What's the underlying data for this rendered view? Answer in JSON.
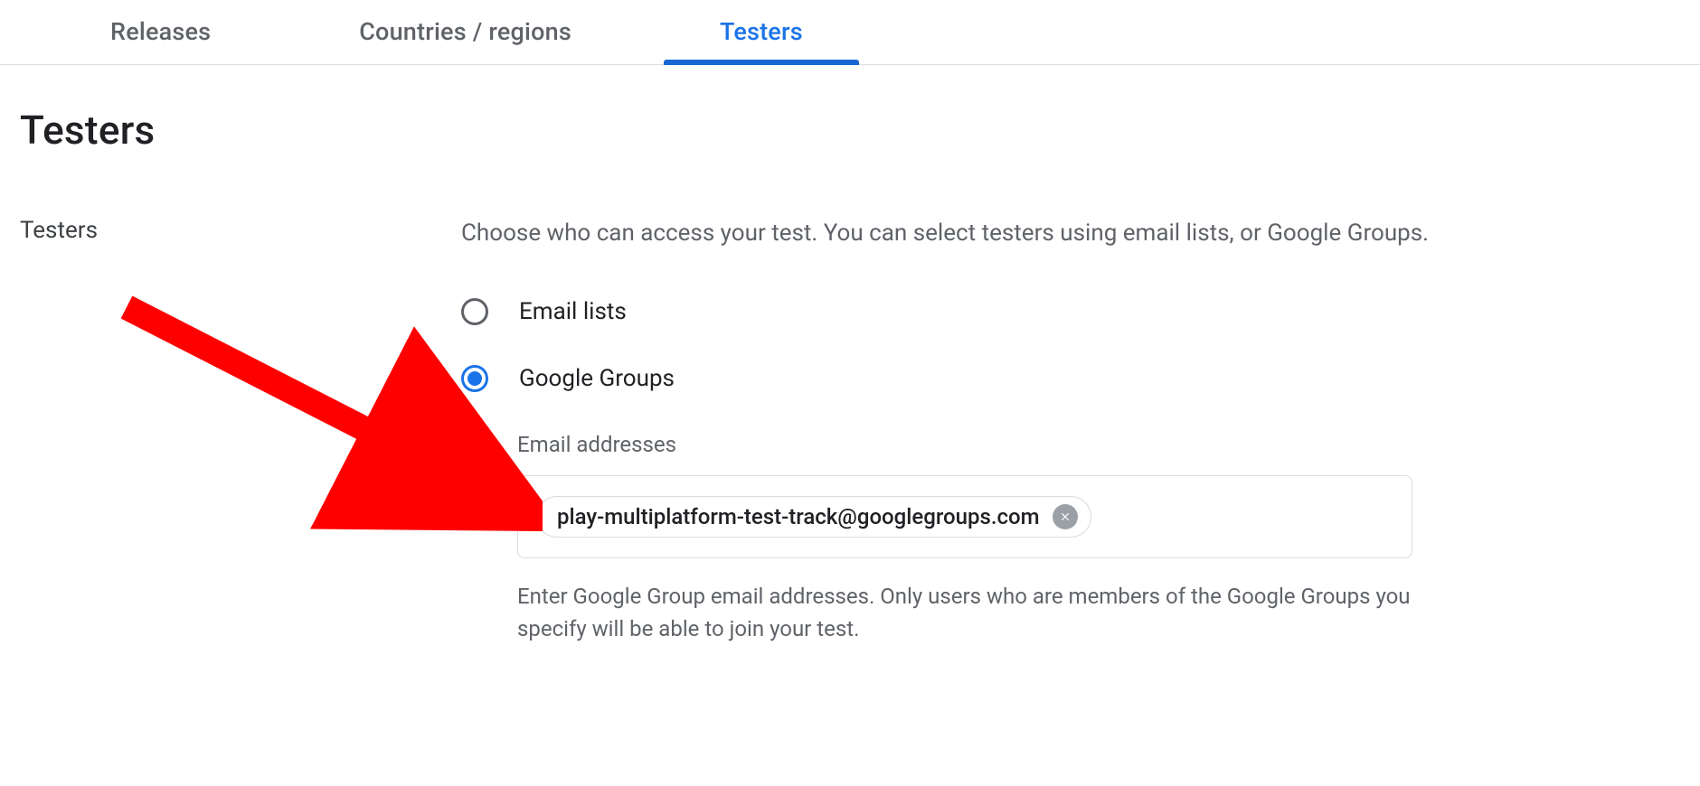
{
  "tabs": [
    {
      "label": "Releases",
      "active": false
    },
    {
      "label": "Countries / regions",
      "active": false
    },
    {
      "label": "Testers",
      "active": true
    }
  ],
  "heading": "Testers",
  "field": {
    "label": "Testers",
    "description": "Choose who can access your test. You can select testers using email lists, or Google Groups.",
    "options": {
      "email_lists": "Email lists",
      "google_groups": "Google Groups"
    },
    "selected_option": "google_groups",
    "email_addresses": {
      "label": "Email addresses",
      "chips": [
        "play-multiplatform-test-track@googlegroups.com"
      ],
      "helper": "Enter Google Group email addresses. Only users who are members of the Google Groups you specify will be able to join your test."
    }
  }
}
